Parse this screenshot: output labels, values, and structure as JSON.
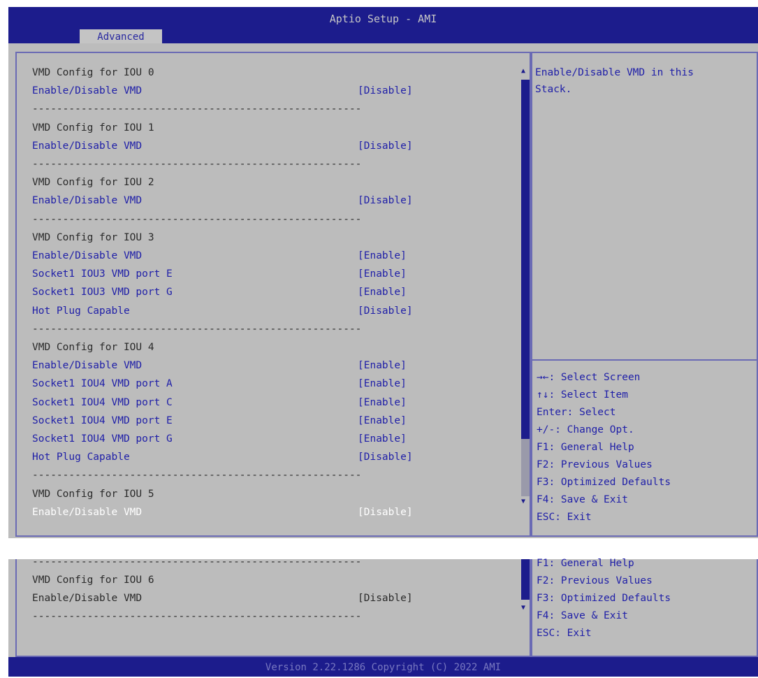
{
  "header": {
    "title": "Aptio Setup - AMI",
    "tab": "Advanced"
  },
  "main": {
    "rows": [
      {
        "type": "heading",
        "label": "VMD Config for IOU 0"
      },
      {
        "type": "item",
        "label": "Enable/Disable VMD",
        "value": "[Disable]"
      },
      {
        "type": "sep",
        "label": "------------------------------------------------------"
      },
      {
        "type": "heading",
        "label": "VMD Config for IOU 1"
      },
      {
        "type": "item",
        "label": "Enable/Disable VMD",
        "value": "[Disable]"
      },
      {
        "type": "sep",
        "label": "------------------------------------------------------"
      },
      {
        "type": "heading",
        "label": "VMD Config for IOU 2"
      },
      {
        "type": "item",
        "label": "Enable/Disable VMD",
        "value": "[Disable]"
      },
      {
        "type": "sep",
        "label": "------------------------------------------------------"
      },
      {
        "type": "heading",
        "label": "VMD Config for IOU 3"
      },
      {
        "type": "item",
        "label": "Enable/Disable VMD",
        "value": "[Enable]"
      },
      {
        "type": "item",
        "label": "Socket1 IOU3 VMD port E",
        "value": "[Enable]"
      },
      {
        "type": "item",
        "label": "Socket1 IOU3 VMD port G",
        "value": "[Enable]"
      },
      {
        "type": "item",
        "label": "Hot Plug Capable",
        "value": "[Disable]"
      },
      {
        "type": "sep",
        "label": "------------------------------------------------------"
      },
      {
        "type": "heading",
        "label": "VMD Config for IOU 4"
      },
      {
        "type": "item",
        "label": "Enable/Disable VMD",
        "value": "[Enable]"
      },
      {
        "type": "item",
        "label": "Socket1 IOU4 VMD port A",
        "value": "[Enable]"
      },
      {
        "type": "item",
        "label": "Socket1 IOU4 VMD port C",
        "value": "[Enable]"
      },
      {
        "type": "item",
        "label": "Socket1 IOU4 VMD port E",
        "value": "[Enable]"
      },
      {
        "type": "item",
        "label": "Socket1 IOU4 VMD port G",
        "value": "[Enable]"
      },
      {
        "type": "item",
        "label": "Hot Plug Capable",
        "value": "[Disable]"
      },
      {
        "type": "sep",
        "label": "------------------------------------------------------"
      },
      {
        "type": "heading",
        "label": "VMD Config for IOU 5"
      },
      {
        "type": "selected",
        "label": "Enable/Disable VMD",
        "value": "[Disable]"
      }
    ],
    "help_text": "Enable/Disable VMD in this\nStack.",
    "keys": [
      "→←: Select Screen",
      "↑↓: Select Item",
      "Enter: Select",
      "+/-: Change Opt.",
      "F1: General Help",
      "F2: Previous Values",
      "F3: Optimized Defaults",
      "F4: Save & Exit",
      "ESC: Exit"
    ]
  },
  "lower": {
    "rows": [
      {
        "type": "sep",
        "label": "------------------------------------------------------"
      },
      {
        "type": "heading",
        "label": "VMD Config for IOU 6"
      },
      {
        "type": "plain",
        "label": "Enable/Disable VMD",
        "value": "[Disable]"
      },
      {
        "type": "sep",
        "label": "------------------------------------------------------"
      }
    ],
    "keys": [
      "F1: General Help",
      "F2: Previous Values",
      "F3: Optimized Defaults",
      "F4: Save & Exit",
      "ESC: Exit"
    ]
  },
  "footer": {
    "text": "Version 2.22.1286 Copyright (C) 2022 AMI"
  },
  "colors": {
    "header_bg": "#1c1c8c",
    "panel_bg": "#bcbcbc",
    "item_text": "#2020a8",
    "selected_text": "#ffffff"
  }
}
